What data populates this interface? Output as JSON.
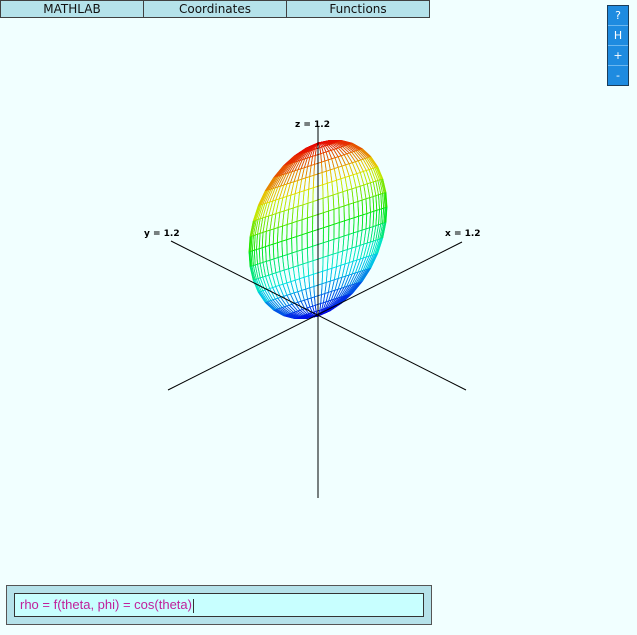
{
  "menu": {
    "items": [
      {
        "label": "MATHLAB"
      },
      {
        "label": "Coordinates"
      },
      {
        "label": "Functions"
      }
    ]
  },
  "side_buttons": [
    {
      "label": "?"
    },
    {
      "label": "H"
    },
    {
      "label": "+"
    },
    {
      "label": "-"
    }
  ],
  "plot": {
    "axes": {
      "z_label": "z = 1.2",
      "y_label": "y = 1.2",
      "x_label": "x = 1.2"
    },
    "surface": {
      "formula": "rho = cos(theta)",
      "color_scheme": "height gradient blue-cyan-green-yellow-red",
      "colors": [
        "#0000ff",
        "#00ffff",
        "#00ff00",
        "#ffff00",
        "#ff0000"
      ]
    }
  },
  "input": {
    "value": "rho = f(theta, phi) = cos(theta)"
  }
}
